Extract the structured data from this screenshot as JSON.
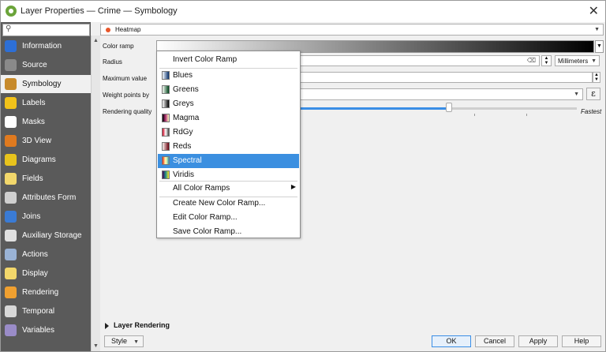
{
  "window": {
    "title": "Layer Properties — Crime — Symbology",
    "close_icon": "✕"
  },
  "sidebar": {
    "search_placeholder": "",
    "items": [
      {
        "label": "Information",
        "icon": "info-icon",
        "color": "#2d6fd6"
      },
      {
        "label": "Source",
        "icon": "source-icon",
        "color": "#8a8a8a"
      },
      {
        "label": "Symbology",
        "icon": "brush-icon",
        "color": "#c78a2b",
        "active": true
      },
      {
        "label": "Labels",
        "icon": "labels-icon",
        "color": "#f2c21a"
      },
      {
        "label": "Masks",
        "icon": "masks-icon",
        "color": "#ffffff"
      },
      {
        "label": "3D View",
        "icon": "cube-icon",
        "color": "#e07a1f"
      },
      {
        "label": "Diagrams",
        "icon": "diagrams-icon",
        "color": "#e8c31c"
      },
      {
        "label": "Fields",
        "icon": "fields-icon",
        "color": "#f2d76b"
      },
      {
        "label": "Attributes Form",
        "icon": "form-icon",
        "color": "#cfcfcf"
      },
      {
        "label": "Joins",
        "icon": "joins-icon",
        "color": "#3a7bd5"
      },
      {
        "label": "Auxiliary Storage",
        "icon": "storage-icon",
        "color": "#e0e0e0"
      },
      {
        "label": "Actions",
        "icon": "gear-icon",
        "color": "#9ab3d6"
      },
      {
        "label": "Display",
        "icon": "display-icon",
        "color": "#f2d76b"
      },
      {
        "label": "Rendering",
        "icon": "rendering-icon",
        "color": "#f0a030"
      },
      {
        "label": "Temporal",
        "icon": "clock-icon",
        "color": "#d8d8d8"
      },
      {
        "label": "Variables",
        "icon": "variables-icon",
        "color": "#9a8cc8"
      }
    ]
  },
  "renderer": {
    "selected": "Heatmap",
    "icon": "heatmap-icon",
    "accent": "#e8562a"
  },
  "form": {
    "color_ramp_label": "Color ramp",
    "radius_label": "Radius",
    "radius_unit": "Millimeters",
    "max_value_label": "Maximum value",
    "weight_label": "Weight points by",
    "weight_expr_icon": "ε",
    "quality_label": "Rendering quality",
    "quality_value": 0.55,
    "quality_end_label": "Fastest"
  },
  "layer_rendering": {
    "label": "Layer Rendering"
  },
  "footer": {
    "style_label": "Style",
    "ok_label": "OK",
    "cancel_label": "Cancel",
    "apply_label": "Apply",
    "help_label": "Help"
  },
  "color_ramp_menu": {
    "invert": "Invert Color Ramp",
    "ramps": [
      {
        "label": "Blues",
        "icon": "blues-ramp-icon",
        "colors": [
          "#f7fbff",
          "#08306b"
        ]
      },
      {
        "label": "Greens",
        "icon": "greens-ramp-icon",
        "colors": [
          "#f7fcf5",
          "#00441b"
        ]
      },
      {
        "label": "Greys",
        "icon": "greys-ramp-icon",
        "colors": [
          "#ffffff",
          "#000000"
        ]
      },
      {
        "label": "Magma",
        "icon": "magma-ramp-icon",
        "colors": [
          "#000004",
          "#b73779",
          "#fcfdbf"
        ]
      },
      {
        "label": "RdGy",
        "icon": "rdgy-ramp-icon",
        "colors": [
          "#ca0020",
          "#ffffff",
          "#404040"
        ]
      },
      {
        "label": "Reds",
        "icon": "reds-ramp-icon",
        "colors": [
          "#fff5f0",
          "#67000d"
        ]
      },
      {
        "label": "Spectral",
        "icon": "spectral-ramp-icon",
        "colors": [
          "#d7191c",
          "#fdae61",
          "#ffffbf",
          "#abdda4",
          "#2b83ba"
        ],
        "selected": true
      },
      {
        "label": "Viridis",
        "icon": "viridis-ramp-icon",
        "colors": [
          "#440154",
          "#21918c",
          "#fde725"
        ]
      }
    ],
    "all_ramps": "All Color Ramps",
    "create": "Create New Color Ramp...",
    "edit": "Edit Color Ramp...",
    "save": "Save Color Ramp..."
  }
}
